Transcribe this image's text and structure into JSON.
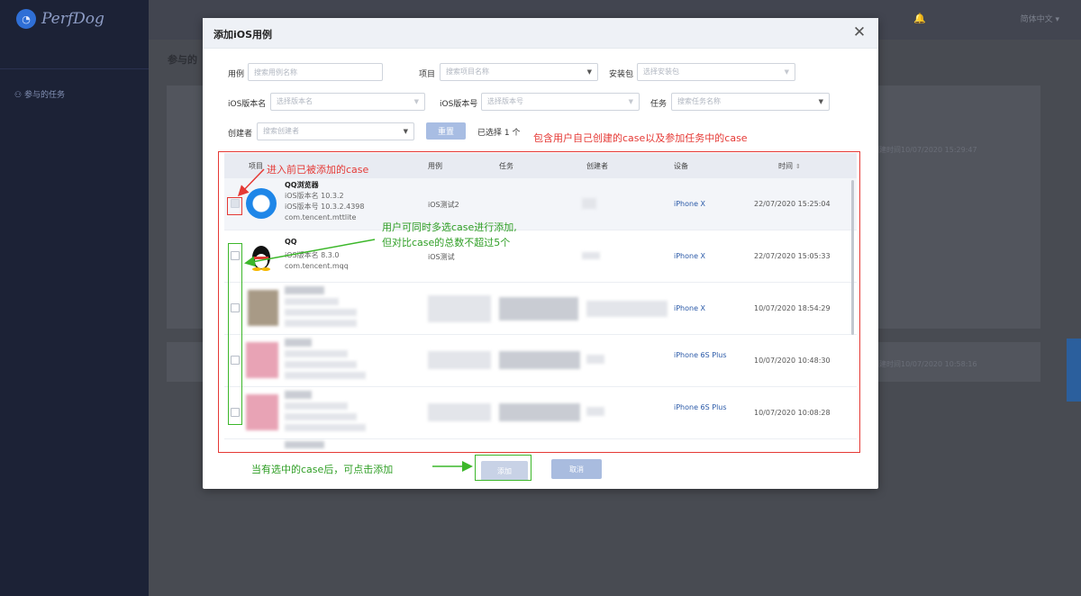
{
  "app": {
    "logo": "PerfDog",
    "sidebar_item": "参与的任务",
    "heading": "参与的",
    "language": "简体中文",
    "card1_text": "创建时间10/07/2020 15:29:47",
    "card2_text": "创建时间10/07/2020 10:58:16"
  },
  "modal": {
    "title": "添加iOS用例",
    "filters": {
      "case_label": "用例",
      "case_placeholder": "搜索用例名称",
      "project_label": "项目",
      "project_placeholder": "搜索项目名称",
      "package_label": "安装包",
      "package_placeholder": "选择安装包",
      "version_name_label": "iOS版本名",
      "version_name_placeholder": "选择版本名",
      "version_code_label": "iOS版本号",
      "version_code_placeholder": "选择版本号",
      "task_label": "任务",
      "task_placeholder": "搜索任务名称",
      "creator_label": "创建者",
      "creator_placeholder": "搜索创建者",
      "reset_button": "重置",
      "selected_count": "已选择 1 个"
    },
    "table": {
      "headers": [
        "项目",
        "用例",
        "任务",
        "创建者",
        "设备",
        "时间"
      ],
      "rows": [
        {
          "name": "QQ浏览器",
          "meta1": "iOS版本名 10.3.2",
          "meta2": "iOS版本号 10.3.2.4398",
          "meta3": "com.tencent.mttlite",
          "case": "iOS测试2",
          "device": "iPhone X",
          "time": "22/07/2020 15:25:04"
        },
        {
          "name": "QQ",
          "meta1": "iOS版本名 8.3.0",
          "meta2": "com.tencent.mqq",
          "case": "iOS测试",
          "device": "iPhone X",
          "time": "22/07/2020 15:05:33"
        },
        {
          "device": "iPhone X",
          "time": "10/07/2020 18:54:29"
        },
        {
          "device": "iPhone 6S Plus",
          "time": "10/07/2020 10:48:30"
        },
        {
          "device": "iPhone 6S Plus",
          "time": "10/07/2020 10:08:28"
        }
      ]
    },
    "add_button": "添加",
    "cancel_button": "取消"
  },
  "annotations": {
    "top_note": "包含用户自己创建的case以及参加任务中的case",
    "added_note": "进入前已被添加的case",
    "multi_note_1": "用户可同时多选case进行添加,",
    "multi_note_2": "但对比case的总数不超过5个",
    "bottom_note": "当有选中的case后，可点击添加"
  },
  "colors": {
    "annotation_red": "#e53935",
    "annotation_green": "#3cb72a",
    "accent": "#a9bcdf"
  }
}
